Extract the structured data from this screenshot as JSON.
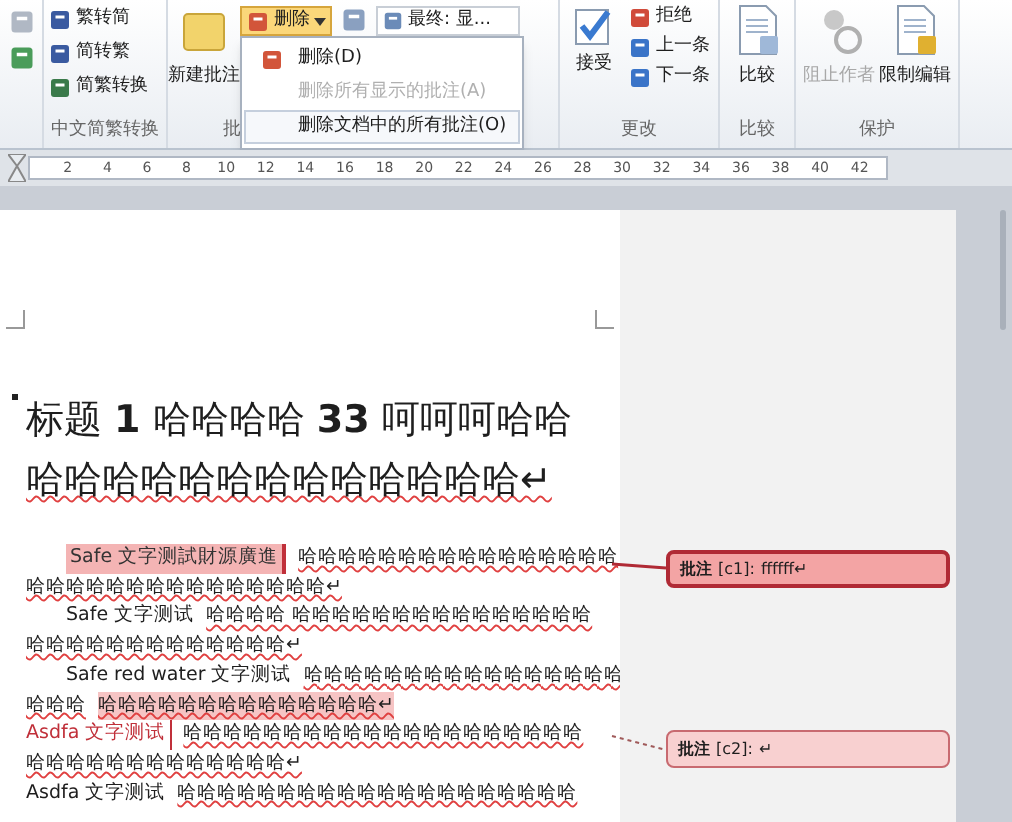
{
  "ribbon": {
    "convert_group": {
      "label": "中文简繁转换",
      "buttons": [
        "繁转简",
        "简转繁",
        "简繁转换"
      ]
    },
    "comments_group": {
      "label": "批",
      "new_comment": "新建批注",
      "delete_button": {
        "label": "删除",
        "pressed": true
      },
      "markup_dropdown": "最终: 显..."
    },
    "changes_group": {
      "label": "更改",
      "accept": "接受",
      "buttons": [
        "拒绝",
        "上一条",
        "下一条"
      ]
    },
    "compare_group": {
      "label": "比较",
      "compare": "比较"
    },
    "protect_group": {
      "label": "保护",
      "buttons": [
        {
          "label": "阻止作者",
          "disabled": true
        },
        {
          "label": "限制编辑",
          "disabled": false
        }
      ]
    }
  },
  "delete_menu": {
    "items": [
      {
        "label": "删除(D)",
        "disabled": false,
        "highlighted": false
      },
      {
        "label": "删除所有显示的批注(A)",
        "disabled": true,
        "highlighted": false
      },
      {
        "label": "删除文档中的所有批注(O)",
        "disabled": false,
        "highlighted": true
      }
    ]
  },
  "ruler": {
    "numbers": [
      "2",
      "4",
      "6",
      "8",
      "10",
      "12",
      "14",
      "16",
      "18",
      "20",
      "22",
      "24",
      "26",
      "28",
      "30",
      "32",
      "34",
      "36",
      "38",
      "40",
      "42"
    ]
  },
  "document": {
    "heading": [
      "标题 **1** 哈哈哈哈 **33** 呵呵呵哈哈",
      "哈哈哈哈哈哈哈哈哈哈哈哈哈↵"
    ],
    "paragraphs": [
      {
        "indent": true,
        "lines": [
          [
            {
              "kind": "anchor-active",
              "text": "Safe 文字测試財源廣進"
            },
            {
              "kind": "squiggle",
              "text": "哈哈哈哈哈哈哈哈哈哈哈哈哈哈哈哈"
            }
          ],
          [
            {
              "kind": "squiggle",
              "text": "哈哈哈哈哈哈哈哈哈哈哈哈哈哈哈↵"
            }
          ]
        ]
      },
      {
        "indent": true,
        "lines": [
          [
            {
              "kind": "plain",
              "text": "Safe 文字测试"
            },
            {
              "kind": "squiggle",
              "text": "哈哈哈哈 哈哈哈哈哈哈哈哈哈哈哈哈哈哈哈"
            }
          ],
          [
            {
              "kind": "squiggle",
              "text": "哈哈哈哈哈哈哈哈哈哈哈哈哈↵"
            }
          ]
        ]
      },
      {
        "indent": true,
        "lines": [
          [
            {
              "kind": "plain",
              "text": "Safe red water 文字测试"
            },
            {
              "kind": "squiggle",
              "text": "哈哈哈哈哈哈哈哈哈哈哈哈哈哈哈哈"
            }
          ],
          [
            {
              "kind": "squiggle",
              "text": "哈哈哈"
            },
            {
              "kind": "highlight",
              "text": "哈哈哈哈哈哈哈哈哈哈哈哈哈哈↵"
            }
          ]
        ]
      },
      {
        "indent": false,
        "lines": [
          [
            {
              "kind": "anchor",
              "text": "Asdfa 文字测试"
            },
            {
              "kind": "squiggle",
              "text": "哈哈哈哈哈哈哈哈哈哈哈哈哈哈哈哈哈哈哈哈"
            }
          ],
          [
            {
              "kind": "squiggle",
              "text": "哈哈哈哈哈哈哈哈哈哈哈哈哈↵"
            }
          ]
        ]
      },
      {
        "indent": false,
        "lines": [
          [
            {
              "kind": "plain",
              "text": "Asdfa 文字测试"
            },
            {
              "kind": "squiggle",
              "text": "哈哈哈哈哈哈哈哈哈哈哈哈哈哈哈哈哈哈哈哈"
            }
          ]
        ]
      }
    ]
  },
  "comments": [
    {
      "label": "批注",
      "ref": "[c1]:",
      "text": "ffffff↵",
      "active": true
    },
    {
      "label": "批注",
      "ref": "[c2]:",
      "text": "↵",
      "active": false
    }
  ]
}
